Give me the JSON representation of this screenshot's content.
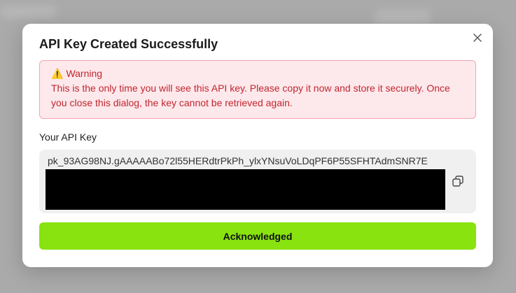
{
  "dialog": {
    "title": "API Key Created Successfully",
    "close_icon": "close-icon"
  },
  "warning": {
    "icon": "warning-icon",
    "heading": "Warning",
    "message": "This is the only time you will see this API key. Please copy it now and store it securely. Once you close this dialog, the key cannot be retrieved again."
  },
  "api_key": {
    "label": "Your API Key",
    "visible_value": "pk_93AG98NJ.gAAAAABo72l55HERdtrPkPh_ylxYNsuVoLDqPF6P55SFHTAdmSNR7E",
    "copy_icon": "copy-icon"
  },
  "actions": {
    "acknowledge_label": "Acknowledged"
  },
  "colors": {
    "accent": "#88e30e",
    "warning_bg": "#fde8ec",
    "warning_border": "#f3a5b1",
    "warning_text": "#c0262d"
  }
}
